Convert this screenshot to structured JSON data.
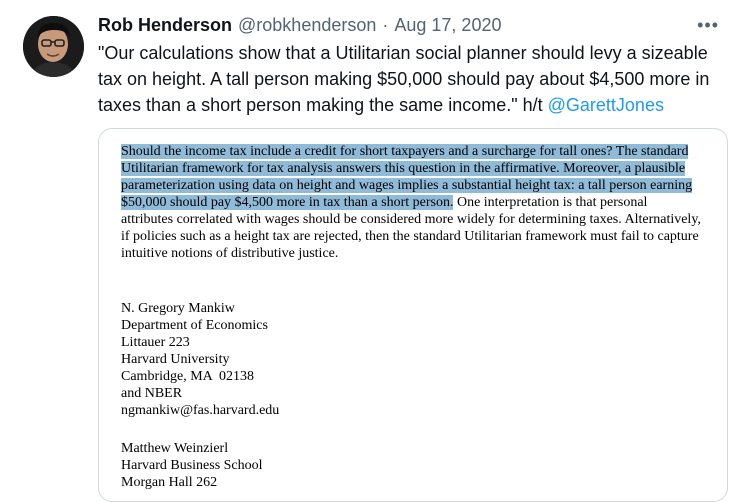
{
  "author": {
    "name": "Rob Henderson",
    "handle": "@robkhenderson",
    "separator": "·",
    "date": "Aug 17, 2020"
  },
  "menu_label": "•••",
  "tweet": {
    "text": "\"Our calculations show that a Utilitarian social planner should levy a sizeable tax on height. A tall person making $50,000 should pay about $4,500 more in taxes than a short person making the same income.\" h/t ",
    "mention": "@GarettJones"
  },
  "paper": {
    "highlighted": "Should the income tax include a credit for short taxpayers and a surcharge for tall ones? The standard Utilitarian framework for tax analysis answers this question in the affirmative. Moreover, a plausible parameterization using data on height and wages implies a substantial height tax: a tall person earning $50,000 should pay $4,500 more in tax than a short person.",
    "rest": " One interpretation is that personal attributes correlated with wages should be considered more widely for determining taxes. Alternatively, if policies such as a height tax are rejected, then the standard Utilitarian framework must fail to capture intuitive notions of distributive justice.",
    "author1": [
      "N. Gregory Mankiw",
      "Department of Economics",
      "Littauer 223",
      "Harvard University",
      "Cambridge, MA  02138",
      "and NBER",
      "ngmankiw@fas.harvard.edu"
    ],
    "author2": [
      "Matthew Weinzierl",
      "Harvard Business School",
      "Morgan Hall 262"
    ]
  }
}
